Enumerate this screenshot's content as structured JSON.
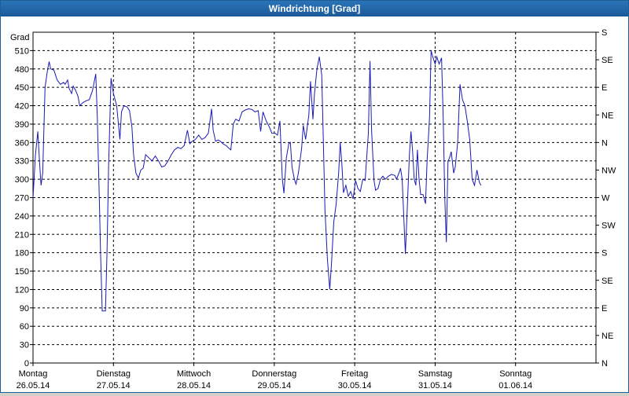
{
  "window": {
    "title": "Windrichtung [Grad]"
  },
  "chart_data": {
    "type": "line",
    "title": "Windrichtung [Grad]",
    "ylabel": "Grad",
    "ylim": [
      0,
      540
    ],
    "yticks": [
      0,
      30,
      60,
      90,
      120,
      150,
      180,
      210,
      240,
      270,
      300,
      330,
      360,
      390,
      420,
      450,
      480,
      510
    ],
    "right_axis_labels": [
      "N",
      "NE",
      "E",
      "SE",
      "S",
      "SW",
      "W",
      "NW",
      "N",
      "NE",
      "E",
      "SE",
      "S"
    ],
    "x_ticks": [
      {
        "day": "Montag",
        "date": "26.05.14"
      },
      {
        "day": "Dienstag",
        "date": "27.05.14"
      },
      {
        "day": "Mittwoch",
        "date": "28.05.14"
      },
      {
        "day": "Donnerstag",
        "date": "29.05.14"
      },
      {
        "day": "Freitag",
        "date": "30.05.14"
      },
      {
        "day": "Samstag",
        "date": "31.05.14"
      },
      {
        "day": "Sonntag",
        "date": "01.06.14"
      }
    ],
    "xlim_days": [
      0,
      7
    ],
    "grid": true,
    "series": [
      {
        "color": "#1a1ab4",
        "points": [
          [
            0.0,
            270
          ],
          [
            0.03,
            340
          ],
          [
            0.06,
            378
          ],
          [
            0.08,
            330
          ],
          [
            0.1,
            290
          ],
          [
            0.12,
            310
          ],
          [
            0.15,
            450
          ],
          [
            0.18,
            478
          ],
          [
            0.2,
            492
          ],
          [
            0.22,
            480
          ],
          [
            0.26,
            478
          ],
          [
            0.3,
            462
          ],
          [
            0.34,
            455
          ],
          [
            0.38,
            458
          ],
          [
            0.4,
            455
          ],
          [
            0.43,
            462
          ],
          [
            0.45,
            448
          ],
          [
            0.48,
            440
          ],
          [
            0.5,
            452
          ],
          [
            0.53,
            445
          ],
          [
            0.56,
            435
          ],
          [
            0.58,
            420
          ],
          [
            0.62,
            425
          ],
          [
            0.66,
            428
          ],
          [
            0.7,
            430
          ],
          [
            0.74,
            445
          ],
          [
            0.78,
            472
          ],
          [
            0.8,
            400
          ],
          [
            0.82,
            290
          ],
          [
            0.84,
            180
          ],
          [
            0.86,
            85
          ],
          [
            0.88,
            85
          ],
          [
            0.9,
            85
          ],
          [
            0.92,
            180
          ],
          [
            0.94,
            320
          ],
          [
            0.97,
            465
          ],
          [
            1.0,
            440
          ],
          [
            1.04,
            420
          ],
          [
            1.08,
            365
          ],
          [
            1.1,
            410
          ],
          [
            1.13,
            420
          ],
          [
            1.17,
            418
          ],
          [
            1.2,
            412
          ],
          [
            1.23,
            385
          ],
          [
            1.25,
            340
          ],
          [
            1.28,
            310
          ],
          [
            1.31,
            302
          ],
          [
            1.34,
            315
          ],
          [
            1.37,
            318
          ],
          [
            1.4,
            340
          ],
          [
            1.44,
            335
          ],
          [
            1.48,
            330
          ],
          [
            1.52,
            338
          ],
          [
            1.56,
            330
          ],
          [
            1.6,
            320
          ],
          [
            1.64,
            322
          ],
          [
            1.68,
            330
          ],
          [
            1.72,
            340
          ],
          [
            1.76,
            348
          ],
          [
            1.8,
            352
          ],
          [
            1.84,
            350
          ],
          [
            1.88,
            355
          ],
          [
            1.92,
            380
          ],
          [
            1.95,
            358
          ],
          [
            1.98,
            362
          ],
          [
            2.02,
            365
          ],
          [
            2.06,
            372
          ],
          [
            2.1,
            365
          ],
          [
            2.14,
            368
          ],
          [
            2.18,
            375
          ],
          [
            2.22,
            415
          ],
          [
            2.24,
            380
          ],
          [
            2.27,
            362
          ],
          [
            2.3,
            364
          ],
          [
            2.33,
            362
          ],
          [
            2.36,
            358
          ],
          [
            2.4,
            355
          ],
          [
            2.44,
            350
          ],
          [
            2.46,
            348
          ],
          [
            2.49,
            390
          ],
          [
            2.52,
            398
          ],
          [
            2.56,
            395
          ],
          [
            2.6,
            410
          ],
          [
            2.64,
            413
          ],
          [
            2.68,
            415
          ],
          [
            2.72,
            414
          ],
          [
            2.76,
            410
          ],
          [
            2.8,
            412
          ],
          [
            2.83,
            378
          ],
          [
            2.86,
            410
          ],
          [
            2.9,
            395
          ],
          [
            2.94,
            385
          ],
          [
            2.97,
            375
          ],
          [
            3.01,
            375
          ],
          [
            3.04,
            372
          ],
          [
            3.07,
            395
          ],
          [
            3.1,
            300
          ],
          [
            3.12,
            277
          ],
          [
            3.15,
            335
          ],
          [
            3.18,
            358
          ],
          [
            3.2,
            360
          ],
          [
            3.22,
            320
          ],
          [
            3.25,
            300
          ],
          [
            3.27,
            292
          ],
          [
            3.3,
            310
          ],
          [
            3.34,
            350
          ],
          [
            3.36,
            388
          ],
          [
            3.39,
            365
          ],
          [
            3.43,
            405
          ],
          [
            3.45,
            460
          ],
          [
            3.48,
            398
          ],
          [
            3.5,
            440
          ],
          [
            3.53,
            480
          ],
          [
            3.56,
            500
          ],
          [
            3.59,
            470
          ],
          [
            3.61,
            360
          ],
          [
            3.63,
            250
          ],
          [
            3.66,
            170
          ],
          [
            3.69,
            120
          ],
          [
            3.71,
            160
          ],
          [
            3.74,
            230
          ],
          [
            3.77,
            260
          ],
          [
            3.8,
            310
          ],
          [
            3.82,
            360
          ],
          [
            3.84,
            325
          ],
          [
            3.86,
            278
          ],
          [
            3.89,
            290
          ],
          [
            3.92,
            272
          ],
          [
            3.95,
            280
          ],
          [
            3.98,
            268
          ],
          [
            4.01,
            298
          ],
          [
            4.04,
            285
          ],
          [
            4.07,
            280
          ],
          [
            4.1,
            300
          ],
          [
            4.13,
            298
          ],
          [
            4.17,
            375
          ],
          [
            4.19,
            493
          ],
          [
            4.21,
            380
          ],
          [
            4.24,
            298
          ],
          [
            4.26,
            282
          ],
          [
            4.29,
            285
          ],
          [
            4.32,
            300
          ],
          [
            4.35,
            305
          ],
          [
            4.38,
            300
          ],
          [
            4.42,
            305
          ],
          [
            4.46,
            308
          ],
          [
            4.5,
            306
          ],
          [
            4.52,
            300
          ],
          [
            4.55,
            310
          ],
          [
            4.57,
            318
          ],
          [
            4.59,
            300
          ],
          [
            4.61,
            240
          ],
          [
            4.63,
            178
          ],
          [
            4.65,
            240
          ],
          [
            4.68,
            340
          ],
          [
            4.7,
            378
          ],
          [
            4.72,
            345
          ],
          [
            4.74,
            300
          ],
          [
            4.76,
            290
          ],
          [
            4.78,
            348
          ],
          [
            4.8,
            300
          ],
          [
            4.82,
            275
          ],
          [
            4.85,
            275
          ],
          [
            4.88,
            260
          ],
          [
            4.9,
            330
          ],
          [
            4.93,
            400
          ],
          [
            4.95,
            510
          ],
          [
            4.97,
            500
          ],
          [
            5.0,
            488
          ],
          [
            5.02,
            500
          ],
          [
            5.05,
            488
          ],
          [
            5.08,
            498
          ],
          [
            5.1,
            400
          ],
          [
            5.12,
            270
          ],
          [
            5.14,
            197
          ],
          [
            5.16,
            330
          ],
          [
            5.18,
            335
          ],
          [
            5.2,
            345
          ],
          [
            5.23,
            310
          ],
          [
            5.25,
            320
          ],
          [
            5.28,
            360
          ],
          [
            5.31,
            455
          ],
          [
            5.34,
            430
          ],
          [
            5.37,
            420
          ],
          [
            5.4,
            395
          ],
          [
            5.43,
            365
          ],
          [
            5.46,
            300
          ],
          [
            5.49,
            290
          ],
          [
            5.52,
            315
          ],
          [
            5.55,
            295
          ],
          [
            5.57,
            290
          ]
        ]
      }
    ]
  }
}
